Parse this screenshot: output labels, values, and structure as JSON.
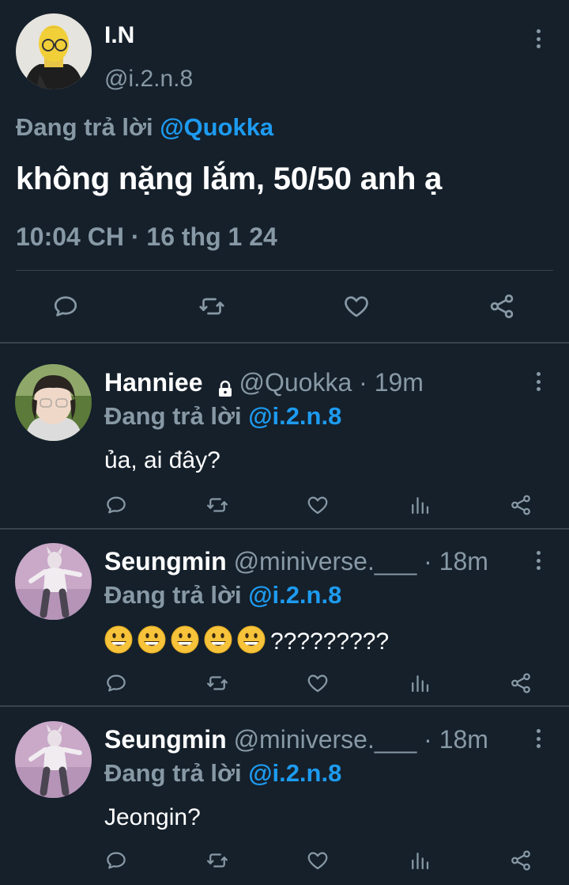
{
  "main_tweet": {
    "author_name": "I.N",
    "author_handle": "@i.2.n.8",
    "replying_prefix": "Đang trả lời ",
    "replying_to": "@Quokka",
    "text": "không nặng lắm, 50/50 anh ạ",
    "timestamp": "10:04 CH · 16 thg 1 24"
  },
  "replies": [
    {
      "name": "Hanniee",
      "handle": "@Quokka",
      "time": "· 19m",
      "replying_prefix": "Đang trả lời ",
      "replying_to": "@i.2.n.8",
      "text": "ủa, ai đây?",
      "locked": true
    },
    {
      "name": "Seungmin",
      "handle": "@miniverse.___",
      "time": "· 18m",
      "replying_prefix": "Đang trả lời ",
      "replying_to": "@i.2.n.8",
      "text": "?????????",
      "emoji_count": 5,
      "emoji": "grinning-face"
    },
    {
      "name": "Seungmin",
      "handle": "@miniverse.___",
      "time": "· 18m",
      "replying_prefix": "Đang trả lời ",
      "replying_to": "@i.2.n.8",
      "text": "Jeongin?"
    }
  ],
  "colors": {
    "background": "#15202b",
    "muted": "#8899a6",
    "link": "#1d9bf0",
    "divider": "#38444d"
  }
}
